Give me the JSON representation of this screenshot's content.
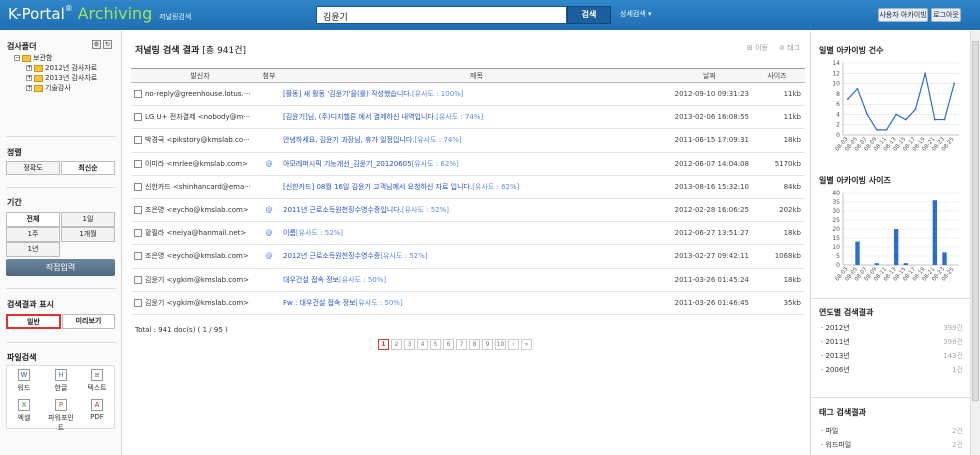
{
  "header": {
    "logo_main": "K-Portal",
    "logo_reg": "®",
    "logo_archiving": "Archiving",
    "logo_sub": "저널링검색",
    "search_value": "김윤기",
    "search_button": "검색",
    "advanced_search": "상세검색 ▾",
    "user_archiving": "사용자 아카이빙",
    "logout": "로그아웃"
  },
  "sidebar": {
    "mailbox_title": "검사폴더",
    "tree": [
      "보관함",
      "2012년 감사자료",
      "2013년 감사자료",
      "기술감사"
    ],
    "sort_title": "정렬",
    "sort_options": [
      "정확도",
      "최신순"
    ],
    "period_title": "기간",
    "period_options": [
      "전체",
      "1일",
      "1주",
      "1개월",
      "1년"
    ],
    "period_direct": "직접입력",
    "display_title": "검색결과 표시",
    "display_options": [
      "일반",
      "미리보기"
    ],
    "filesearch_title": "파일검색",
    "file_types": [
      "워드",
      "한글",
      "텍스트",
      "엑셀",
      "파워포인트",
      "PDF"
    ]
  },
  "main": {
    "title": "저널링 검색 결과",
    "count_text": "[총 941건]",
    "action_move": "⊞ 이동",
    "action_tag": "⊘ 태그",
    "columns": {
      "sender": "발신자",
      "attach": "첨부",
      "subject": "제목",
      "date": "날짜",
      "size": "사이즈"
    },
    "rows": [
      {
        "sender": "no-reply@greenhouse.lotus.···",
        "attach": "",
        "subject": "[활동] 새 활동 '김윤기'을(를) 작성했습니다.",
        "sim": "[유사도 : 100%]",
        "date": "2012-09-10 09:31:23",
        "size": "11kb"
      },
      {
        "sender": "LG U+ 전자결제 <nobody@m···",
        "attach": "",
        "subject": "[김윤기]님, (주)디지헬른 에서 결제하신 내역입니다.",
        "sim": "[유사도 : 74%]",
        "date": "2013-02-06 16:08:55",
        "size": "11kb"
      },
      {
        "sender": "박경국 <pikstory@kmslab.co···",
        "attach": "",
        "subject": "안녕하세요, 김윤기 과장님, 휴가 일정입니다.",
        "sim": "[유사도 : 74%]",
        "date": "2011-06-15 17:09:31",
        "size": "18kb"
      },
      {
        "sender": "이미라 <mrlee@kmslab.com>",
        "attach": "@",
        "subject": "아모레퍼시픽 기능개선_김윤기_20120605",
        "sim": "[유사도 : 62%]",
        "date": "2012-06-07 14:04:08",
        "size": "5170kb"
      },
      {
        "sender": "신한카드 <shinhancard@ema···",
        "attach": "",
        "subject": "[신한카드] 08월 16일 김윤기 고객님께서 요청하신 자료 입니다.",
        "sim": "[유사도 : 62%]",
        "date": "2013-08-16 15:32:10",
        "size": "84kb"
      },
      {
        "sender": "조은영 <eycho@kmslab.com>",
        "attach": "@",
        "subject": "2011년 근로소득원천징수영수증입니다.",
        "sim": "[유사도 : 52%]",
        "date": "2012-02-28 16:06:25",
        "size": "202kb"
      },
      {
        "sender": "황필라 <neiya@hanmail.net>",
        "attach": "@",
        "subject": "이름",
        "sim": "[유사도 : 52%]",
        "date": "2012-06-27 13:51:27",
        "size": "18kb"
      },
      {
        "sender": "조은영 <eycho@kmslab.com>",
        "attach": "@",
        "subject": "2012년 근로소득원천징수영수증",
        "sim": "[유사도 : 52%]",
        "date": "2013-02-27 09:42:11",
        "size": "1068kb"
      },
      {
        "sender": "김윤기 <ygkim@kmslab.com>",
        "attach": "",
        "subject": "대우건설 접속 정보",
        "sim": "[유사도 : 50%]",
        "date": "2011-03-26 01:45:24",
        "size": "18kb"
      },
      {
        "sender": "김윤기 <ygkim@kmslab.com>",
        "attach": "",
        "subject": "Fw : 대우건설 접속 정보",
        "sim": "[유사도 : 50%]",
        "date": "2011-03-26 01:46:45",
        "size": "35kb"
      }
    ],
    "total_text": "Total : 941 doc(s) ( 1 / 95 )",
    "pages": [
      "1",
      "2",
      "3",
      "4",
      "5",
      "6",
      "7",
      "8",
      "9",
      "10",
      "›",
      "»"
    ]
  },
  "right": {
    "daily_count_title": "일별 아카이빙 건수",
    "daily_size_title": "일별 아카이빙 사이즈",
    "year_title": "연도별 검색결과",
    "years": [
      {
        "label": "2012년",
        "count": "399건"
      },
      {
        "label": "2011년",
        "count": "398건"
      },
      {
        "label": "2013년",
        "count": "143건"
      },
      {
        "label": "2006년",
        "count": "1건"
      }
    ],
    "tag_title": "태그 검색결과",
    "tags": [
      {
        "label": "파일",
        "count": "2건"
      },
      {
        "label": "워드파일",
        "count": "2건"
      }
    ]
  },
  "chart_data": [
    {
      "type": "line",
      "title": "일별 아카이빙 건수",
      "categories": [
        "08-03",
        "08-05",
        "08-07",
        "08-09",
        "08-11",
        "08-13",
        "08-15",
        "08-17",
        "08-19",
        "08-21",
        "08-23",
        "08-25"
      ],
      "series": [
        {
          "values": [
            7,
            9,
            4,
            1,
            1,
            4,
            3,
            5,
            12,
            3,
            3,
            10
          ]
        }
      ],
      "ylim": [
        0,
        14
      ],
      "yticks": [
        0,
        2,
        4,
        6,
        8,
        10,
        12,
        14
      ],
      "grid": true
    },
    {
      "type": "bar",
      "title": "일별 아카이빙 사이즈",
      "categories": [
        "08-03",
        "08-05",
        "08-07",
        "08-09",
        "08-11",
        "08-13",
        "08-15",
        "08-17",
        "08-19",
        "08-21",
        "08-23",
        "08-25"
      ],
      "series": [
        {
          "values": [
            0,
            13,
            0,
            1,
            0,
            20,
            1,
            0,
            0,
            36,
            7,
            0
          ]
        }
      ],
      "ylim": [
        0,
        40
      ],
      "yticks": [
        0,
        5,
        10,
        15,
        20,
        25,
        30,
        35,
        40
      ],
      "grid": true
    }
  ]
}
